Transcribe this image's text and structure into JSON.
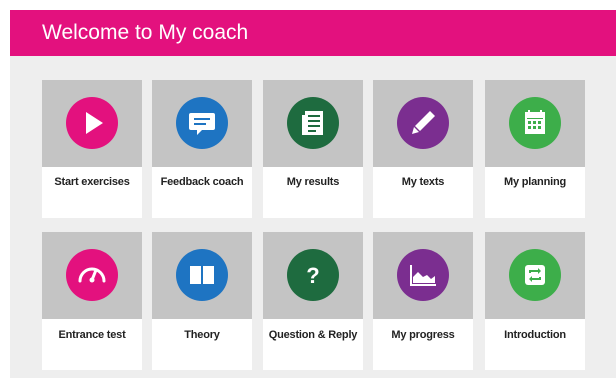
{
  "header": {
    "title": "Welcome to My coach",
    "color": "#e3117e"
  },
  "tiles": [
    {
      "label": "Start exercises",
      "icon": "play-icon",
      "color": "#e3117e"
    },
    {
      "label": "Feedback coach",
      "icon": "chat-bubble-icon",
      "color": "#1e74c2"
    },
    {
      "label": "My results",
      "icon": "clipboard-icon",
      "color": "#1e6b3f"
    },
    {
      "label": "My texts",
      "icon": "pen-icon",
      "color": "#7b2e90"
    },
    {
      "label": "My planning",
      "icon": "calendar-icon",
      "color": "#3dae4a"
    },
    {
      "label": "Entrance test",
      "icon": "gauge-icon",
      "color": "#e3117e"
    },
    {
      "label": "Theory",
      "icon": "book-icon",
      "color": "#1e74c2"
    },
    {
      "label": "Question & Reply",
      "icon": "question-icon",
      "color": "#1e6b3f"
    },
    {
      "label": "My progress",
      "icon": "chart-icon",
      "color": "#7b2e90"
    },
    {
      "label": "Introduction",
      "icon": "refresh-icon",
      "color": "#3dae4a"
    }
  ]
}
